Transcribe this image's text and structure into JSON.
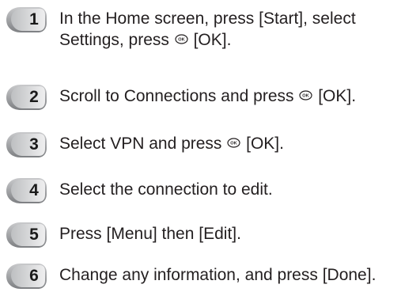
{
  "steps": [
    {
      "number": "1",
      "line1": "In the Home screen, press [Start], select",
      "line2_before": "Settings, press",
      "line2_after": "[OK].",
      "icon": "ok-button-icon"
    },
    {
      "number": "2",
      "before": "Scroll to Connections and press",
      "after": "[OK].",
      "icon": "ok-button-icon"
    },
    {
      "number": "3",
      "before": "Select VPN and press",
      "after": "[OK].",
      "icon": "ok-button-icon"
    },
    {
      "number": "4",
      "text": "Select the connection to edit."
    },
    {
      "number": "5",
      "text": "Press [Menu] then [Edit]."
    },
    {
      "number": "6",
      "text": "Change any information, and press [Done]."
    }
  ],
  "colors": {
    "badge_light": "#e6e7e8",
    "badge_dark": "#8a8c8f",
    "text": "#231f20"
  }
}
